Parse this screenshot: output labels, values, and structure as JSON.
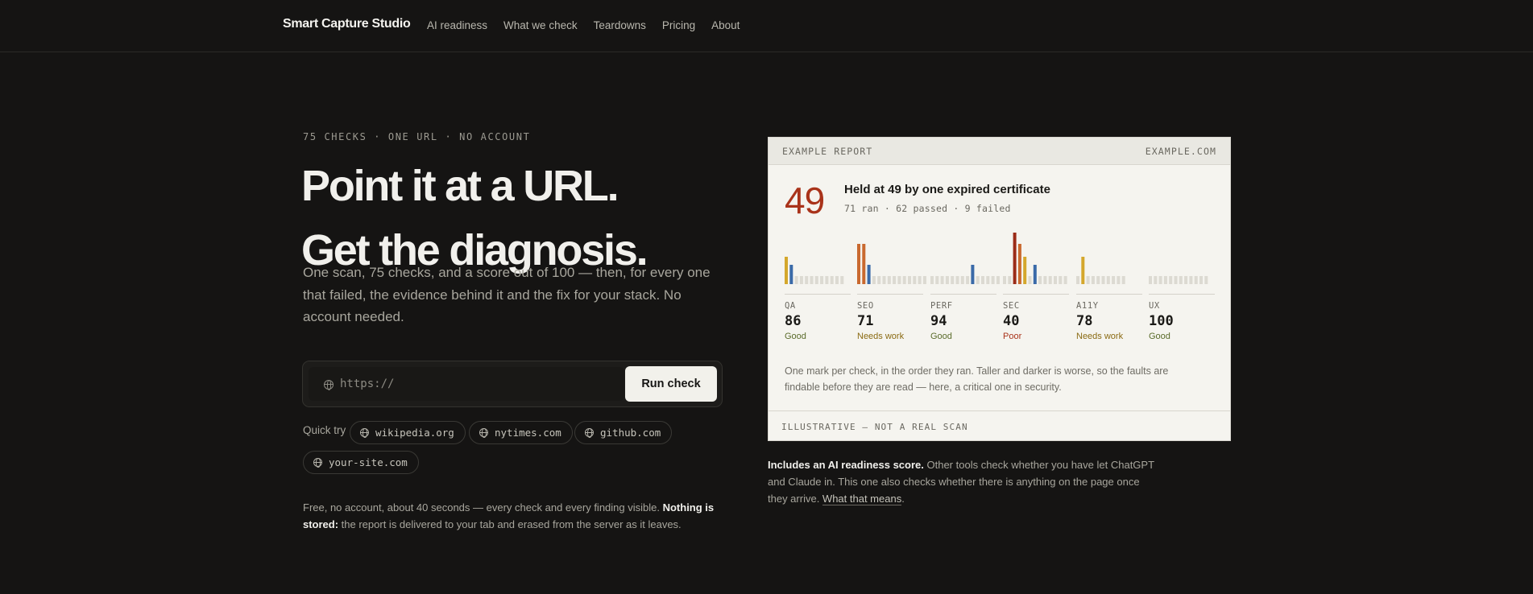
{
  "nav": {
    "brand": "Smart Capture Studio",
    "links": [
      "AI readiness",
      "What we check",
      "Teardowns",
      "Pricing",
      "About"
    ]
  },
  "hero": {
    "eyebrow": "75 CHECKS · ONE URL · NO ACCOUNT",
    "headline_line1": "Point it at a URL.",
    "headline_line2": "Get the diagnosis.",
    "lede": "One scan, 75 checks, and a score out of 100 — then, for every one that failed, the evidence behind it and the fix for your stack. No account needed."
  },
  "search": {
    "placeholder": "https://",
    "icon": "globe-icon",
    "button_label": "Run check"
  },
  "quick_try": {
    "label": "Quick try",
    "chips": [
      "wikipedia.org",
      "nytimes.com",
      "github.com",
      "your-site.com"
    ]
  },
  "footnote": {
    "text": "Free, no account, about 40 seconds — every check and every finding visible. ",
    "bold": "Nothing is stored:",
    "rest": " the report is delivered to your tab and erased from the server as it leaves."
  },
  "report": {
    "label": "EXAMPLE REPORT",
    "domain": "EXAMPLE.COM",
    "score": "49",
    "title": "Held at 49 by one expired certificate",
    "subtitle": "71 ran · 62 passed · 9 failed",
    "categories": [
      {
        "name": "QA",
        "score": "86",
        "status": "Good",
        "status_color": "#5a6b2a"
      },
      {
        "name": "SEO",
        "score": "71",
        "status": "Needs work",
        "status_color": "#8a6a12"
      },
      {
        "name": "PERF",
        "score": "94",
        "status": "Good",
        "status_color": "#5a6b2a"
      },
      {
        "name": "SEC",
        "score": "40",
        "status": "Poor",
        "status_color": "#a9331a"
      },
      {
        "name": "A11Y",
        "score": "78",
        "status": "Needs work",
        "status_color": "#8a6a12"
      },
      {
        "name": "UX",
        "score": "100",
        "status": "Good",
        "status_color": "#5a6b2a"
      }
    ],
    "check_marks": [
      [
        2,
        5,
        0,
        0,
        0,
        0,
        0,
        0,
        0,
        0,
        0,
        0
      ],
      [
        6,
        5,
        0,
        0,
        0,
        0,
        0,
        0,
        0,
        0,
        0,
        0,
        0,
        0
      ],
      [
        0,
        0,
        0,
        0,
        0,
        0,
        0,
        0,
        0,
        0,
        0,
        0,
        0,
        0
      ],
      [
        0,
        0,
        0,
        0,
        0,
        0,
        4,
        0,
        0,
        0,
        0,
        0,
        0
      ],
      [
        0,
        0,
        0,
        0,
        0,
        0,
        0,
        0,
        0,
        0
      ],
      [
        0,
        0,
        0,
        0,
        0,
        0,
        0,
        0,
        0,
        0,
        0,
        0
      ]
    ],
    "mark_colors": {
      "0": "#dcdad2",
      "1": "#d4a72c",
      "2": "#d4a72c",
      "3": "#d4a72c",
      "4": "#3a6aa8",
      "5": "#3a6aa8",
      "6": "#c9692f",
      "7": "#b33a1f",
      "8": "#9b2b17"
    },
    "caption": "One mark per check, in the order they ran. Taller and darker is worse, so the faults are findable before they are read — here, a critical one in security.",
    "footer": "ILLUSTRATIVE — NOT A REAL SCAN"
  },
  "ai_note": {
    "bold": "Includes an AI readiness score.",
    "text": " Other tools check whether you have let ChatGPT and Claude in. This one also checks whether there is anything on the page once they arrive. ",
    "link": "What that means",
    "end": "."
  }
}
